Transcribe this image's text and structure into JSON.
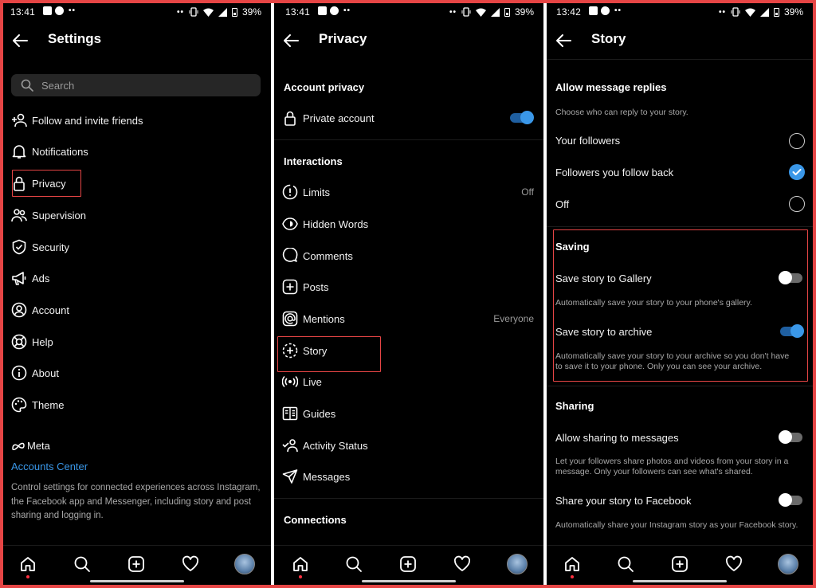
{
  "status_bar": [
    {
      "time": "13:41",
      "battery": "39%"
    },
    {
      "time": "13:41",
      "battery": "39%"
    },
    {
      "time": "13:42",
      "battery": "39%"
    }
  ],
  "settings": {
    "title": "Settings",
    "search_placeholder": "Search",
    "items": [
      {
        "label": "Follow and invite friends",
        "icon": "add-person-icon"
      },
      {
        "label": "Notifications",
        "icon": "bell-icon"
      },
      {
        "label": "Privacy",
        "icon": "lock-icon"
      },
      {
        "label": "Supervision",
        "icon": "people-icon"
      },
      {
        "label": "Security",
        "icon": "shield-icon"
      },
      {
        "label": "Ads",
        "icon": "megaphone-icon"
      },
      {
        "label": "Account",
        "icon": "account-icon"
      },
      {
        "label": "Help",
        "icon": "lifebuoy-icon"
      },
      {
        "label": "About",
        "icon": "info-icon"
      },
      {
        "label": "Theme",
        "icon": "palette-icon"
      }
    ],
    "meta_brand": "Meta",
    "accounts_center": "Accounts Center",
    "description": "Control settings for connected experiences across Instagram, the Facebook app and Messenger, including story and post sharing and logging in."
  },
  "privacy": {
    "title": "Privacy",
    "account_privacy_heading": "Account privacy",
    "private_account_label": "Private account",
    "private_account_on": true,
    "interactions_heading": "Interactions",
    "items": [
      {
        "label": "Limits",
        "value": "Off",
        "icon": "limits-icon"
      },
      {
        "label": "Hidden Words",
        "value": "",
        "icon": "hidden-words-icon"
      },
      {
        "label": "Comments",
        "value": "",
        "icon": "comment-icon"
      },
      {
        "label": "Posts",
        "value": "",
        "icon": "plus-square-icon"
      },
      {
        "label": "Mentions",
        "value": "Everyone",
        "icon": "at-icon"
      },
      {
        "label": "Story",
        "value": "",
        "icon": "story-icon"
      },
      {
        "label": "Live",
        "value": "",
        "icon": "live-icon"
      },
      {
        "label": "Guides",
        "value": "",
        "icon": "guides-icon"
      },
      {
        "label": "Activity Status",
        "value": "",
        "icon": "activity-status-icon"
      },
      {
        "label": "Messages",
        "value": "",
        "icon": "send-icon"
      }
    ],
    "connections_heading": "Connections"
  },
  "story": {
    "title": "Story",
    "replies_heading": "Allow message replies",
    "replies_sub": "Choose who can reply to your story.",
    "reply_options": [
      {
        "label": "Your followers",
        "selected": false
      },
      {
        "label": "Followers you follow back",
        "selected": true
      },
      {
        "label": "Off",
        "selected": false
      }
    ],
    "saving_heading": "Saving",
    "save_gallery_label": "Save story to Gallery",
    "save_gallery_on": false,
    "save_gallery_desc": "Automatically save your story to your phone's gallery.",
    "save_archive_label": "Save story to archive",
    "save_archive_on": true,
    "save_archive_desc": "Automatically save your story to your archive so you don't have to save it to your phone. Only you can see your archive.",
    "sharing_heading": "Sharing",
    "share_messages_label": "Allow sharing to messages",
    "share_messages_on": false,
    "share_messages_desc": "Let your followers share photos and videos from your story in a message. Only your followers can see what's shared.",
    "share_facebook_label": "Share your story to Facebook",
    "share_facebook_on": false,
    "share_facebook_desc": "Automatically share your Instagram story as your Facebook story."
  },
  "nav": [
    "home-icon",
    "search-icon",
    "create-icon",
    "heart-icon",
    "profile-avatar"
  ],
  "colors": {
    "accent": "#3a97e8",
    "highlight": "#e64545",
    "background": "#000000"
  }
}
